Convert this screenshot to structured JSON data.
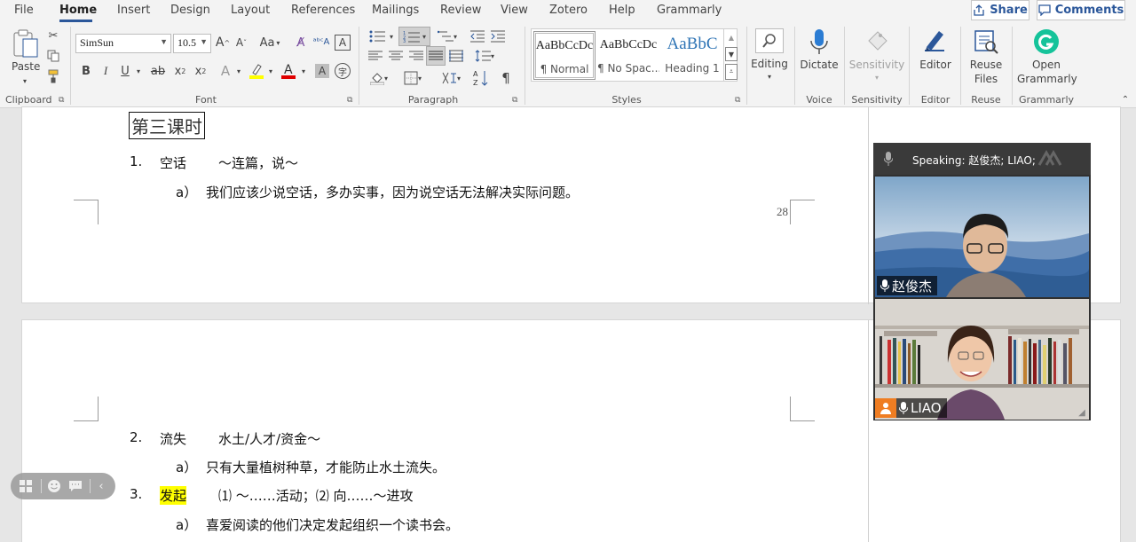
{
  "menubar": {
    "tabs": [
      {
        "label": "File",
        "name": "tab-file"
      },
      {
        "label": "Home",
        "name": "tab-home",
        "active": true
      },
      {
        "label": "Insert",
        "name": "tab-insert"
      },
      {
        "label": "Design",
        "name": "tab-design"
      },
      {
        "label": "Layout",
        "name": "tab-layout"
      },
      {
        "label": "References",
        "name": "tab-references"
      },
      {
        "label": "Mailings",
        "name": "tab-mailings"
      },
      {
        "label": "Review",
        "name": "tab-review"
      },
      {
        "label": "View",
        "name": "tab-view"
      },
      {
        "label": "Zotero",
        "name": "tab-zotero"
      },
      {
        "label": "Help",
        "name": "tab-help"
      },
      {
        "label": "Grammarly",
        "name": "tab-grammarly"
      }
    ],
    "share_label": "Share",
    "comments_label": "Comments"
  },
  "ribbon": {
    "clipboard": {
      "paste_label": "Paste",
      "group_label": "Clipboard"
    },
    "font": {
      "font_name": "SimSun",
      "font_size": "10.5",
      "case_label": "Aa",
      "group_label": "Font",
      "bold": "B",
      "italic": "I",
      "underline": "U",
      "strike": "ab",
      "subscript": "x",
      "superscript": "x",
      "subscript_mark": "2",
      "superscript_mark": "2"
    },
    "paragraph": {
      "group_label": "Paragraph",
      "pilcrow": "¶"
    },
    "styles": {
      "group_label": "Styles",
      "tiles": [
        {
          "sample": "AaBbCcDc",
          "name": "¶ Normal",
          "selected": true
        },
        {
          "sample": "AaBbCcDc",
          "name": "¶ No Spac..."
        },
        {
          "sample": "AaBbC",
          "name": "Heading 1",
          "heading": true
        }
      ]
    },
    "editing": {
      "label": "Editing"
    },
    "voice": {
      "dictate_label": "Dictate",
      "group_label": "Voice"
    },
    "sensitivity": {
      "label": "Sensitivity",
      "group_label": "Sensitivity"
    },
    "editor": {
      "label": "Editor",
      "group_label": "Editor"
    },
    "reuse": {
      "label_line1": "Reuse",
      "label_line2": "Files",
      "group_label": "Reuse Files"
    },
    "grammarly": {
      "label_line1": "Open",
      "label_line2": "Grammarly",
      "group_label": "Grammarly"
    }
  },
  "document": {
    "page1": {
      "title": "第三课时",
      "item1_number": "1.",
      "item1_term": "空话",
      "item1_pattern": "～连篇，说～",
      "item1_sub_marker": "a）",
      "item1_sub_text": "我们应该少说空话，多办实事，因为说空话无法解决实际问题。",
      "page_number": "28"
    },
    "page2": {
      "item2_number": "2.",
      "item2_term": "流失",
      "item2_pattern": "水土/人才/资金～",
      "item2_sub_marker": "a）",
      "item2_sub_text": "只有大量植树种草，才能防止水土流失。",
      "item3_number": "3.",
      "item3_term": "发起",
      "item3_pattern": "⑴ ～……活动；⑵ 向……～进攻",
      "item3_sub_marker": "a）",
      "item3_sub_text": "喜爱阅读的他们决定发起组织一个读书会。"
    }
  },
  "video": {
    "speaking_text": "Speaking: 赵俊杰; LIAO;",
    "participants": [
      {
        "name": "赵俊杰",
        "active": true
      },
      {
        "name": "LIAO",
        "active": false
      }
    ],
    "colors": {
      "active_border": "#23d96b",
      "panel_bg": "#303030"
    }
  },
  "colors": {
    "accent": "#2b579a",
    "highlight": "#ffff00"
  }
}
